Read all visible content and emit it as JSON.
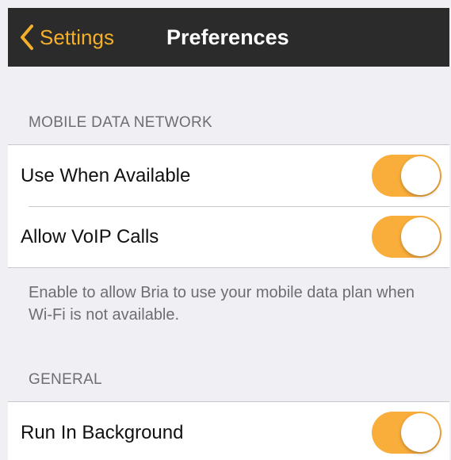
{
  "navbar": {
    "back_label": "Settings",
    "title": "Preferences",
    "accent_color": "#f4b02a",
    "background_color": "#2b2b2b"
  },
  "sections": {
    "mobile_data": {
      "header": "MOBILE DATA NETWORK",
      "rows": [
        {
          "label": "Use When Available",
          "toggle_on": true
        },
        {
          "label": "Allow VoIP Calls",
          "toggle_on": true
        }
      ],
      "footer": "Enable to allow Bria to use your mobile data plan when Wi-Fi is not available."
    },
    "general": {
      "header": "GENERAL",
      "rows": [
        {
          "label": "Run In Background",
          "toggle_on": true
        }
      ]
    }
  },
  "toggle_on_color": "#f9ad3b",
  "icons": {
    "back": "chevron-left-icon"
  }
}
